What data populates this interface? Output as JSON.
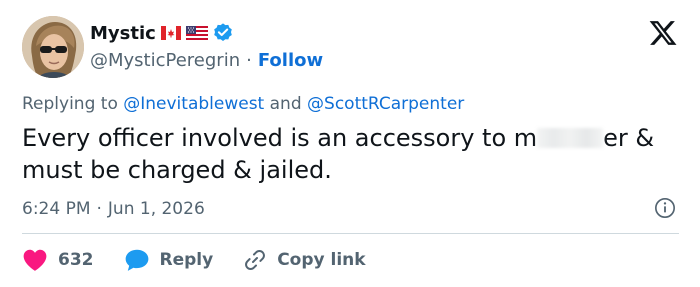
{
  "author": {
    "display_name": "Mystic",
    "handle": "@MysticPeregrin",
    "flags": [
      "canada-flag",
      "usa-flag"
    ],
    "verified": true,
    "follow_label": "Follow",
    "separator": "·"
  },
  "reply_context": {
    "prefix": "Replying to",
    "mention_1": "@Inevitablewest",
    "joiner": "and",
    "mention_2": "@ScottRCarpenter"
  },
  "tweet": {
    "text_before_censor": "Every officer involved is an accessory to m",
    "text_after_censor": "er &",
    "line_2": "must be charged & jailed."
  },
  "meta": {
    "time": "6:24 PM",
    "separator": "·",
    "date": "Jun 1, 2026"
  },
  "actions": {
    "like_count": "632",
    "reply_label": "Reply",
    "copy_link_label": "Copy link"
  },
  "colors": {
    "like": "#f91880",
    "reply": "#1d9bf0",
    "link": "#0f6fd6",
    "muted": "#536471",
    "verified": "#1d9bf0"
  },
  "icons": {
    "brand": "x-logo-icon",
    "verified": "verified-badge-icon",
    "info": "info-icon",
    "like": "heart-icon",
    "reply": "speech-bubble-icon",
    "copy": "link-icon"
  }
}
